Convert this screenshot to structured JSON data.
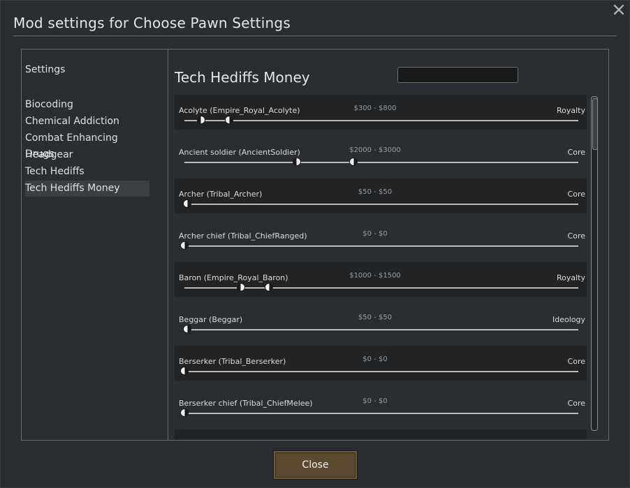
{
  "window": {
    "title": "Mod settings for Choose Pawn Settings",
    "close_icon": "×"
  },
  "sidebar": {
    "heading": "Settings",
    "items": [
      {
        "label": "Biocoding"
      },
      {
        "label": "Chemical Addiction"
      },
      {
        "label": "Combat Enhancing Drugs"
      },
      {
        "label": "Headgear"
      },
      {
        "label": "Tech Hediffs"
      },
      {
        "label": "Tech Hediffs Money",
        "selected": true
      }
    ]
  },
  "content": {
    "section_title": "Tech Hediffs Money",
    "search": {
      "value": "",
      "placeholder": ""
    }
  },
  "rows": [
    {
      "label": "Acolyte (Empire_Royal_Acolyte)",
      "range": "$300 - $800",
      "source": "Royalty",
      "low": 300,
      "high": 800
    },
    {
      "label": "Ancient soldier (AncientSoldier)",
      "range": "$2000 - $3000",
      "source": "Core",
      "low": 2000,
      "high": 3000
    },
    {
      "label": "Archer (Tribal_Archer)",
      "range": "$50 - $50",
      "source": "Core",
      "low": 50,
      "high": 50
    },
    {
      "label": "Archer chief (Tribal_ChiefRanged)",
      "range": "$0 - $0",
      "source": "Core",
      "low": 0,
      "high": 0
    },
    {
      "label": "Baron (Empire_Royal_Baron)",
      "range": "$1000 - $1500",
      "source": "Royalty",
      "low": 1000,
      "high": 1500
    },
    {
      "label": "Beggar (Beggar)",
      "range": "$50 - $50",
      "source": "Ideology",
      "low": 50,
      "high": 50
    },
    {
      "label": "Berserker (Tribal_Berserker)",
      "range": "$0 - $0",
      "source": "Core",
      "low": 0,
      "high": 0
    },
    {
      "label": "Berserker chief (Tribal_ChiefMelee)",
      "range": "$0 - $0",
      "source": "Core",
      "low": 0,
      "high": 0
    }
  ],
  "slider_scale": {
    "max": 7000
  },
  "buttons": {
    "close": "Close"
  },
  "colors": {
    "accent_button": "#5a4a30",
    "row_shade": "#212325"
  }
}
